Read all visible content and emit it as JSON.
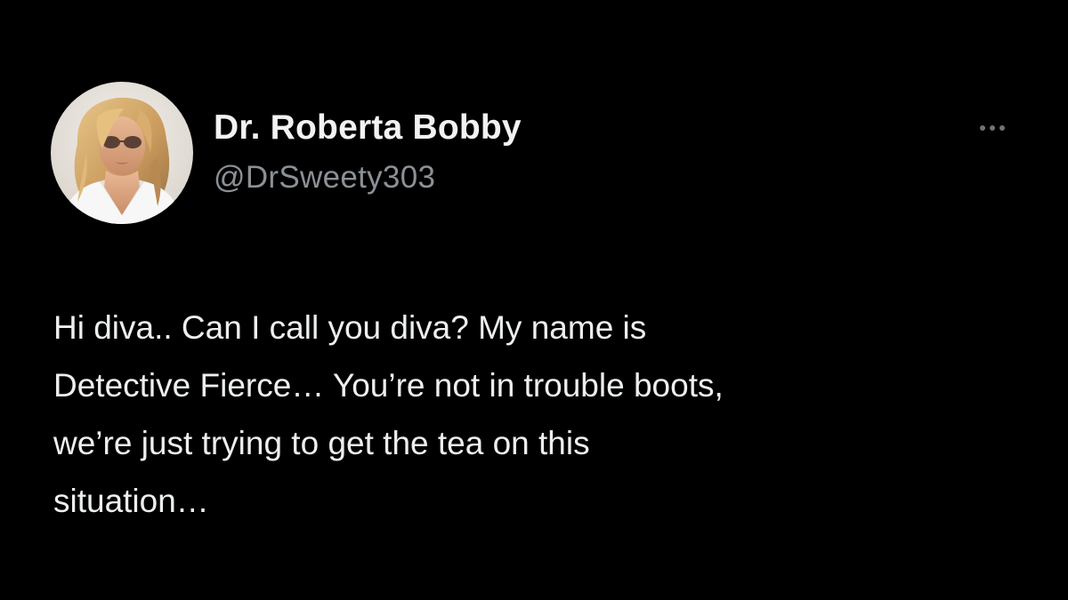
{
  "tweet": {
    "author": {
      "display_name": "Dr. Roberta Bobby",
      "handle": "@DrSweety303",
      "avatar_icon": "profile-photo"
    },
    "more_icon": "ellipsis-icon",
    "text_lines": [
      "Hi diva.. Can I call you diva? My name is",
      "Detective Fierce… You’re not in trouble boots,",
      "we’re just trying to get the tea on this",
      "situation…"
    ]
  },
  "colors": {
    "background": "#000000",
    "primary_text": "#e7e9ea",
    "secondary_text": "#8b9096"
  }
}
